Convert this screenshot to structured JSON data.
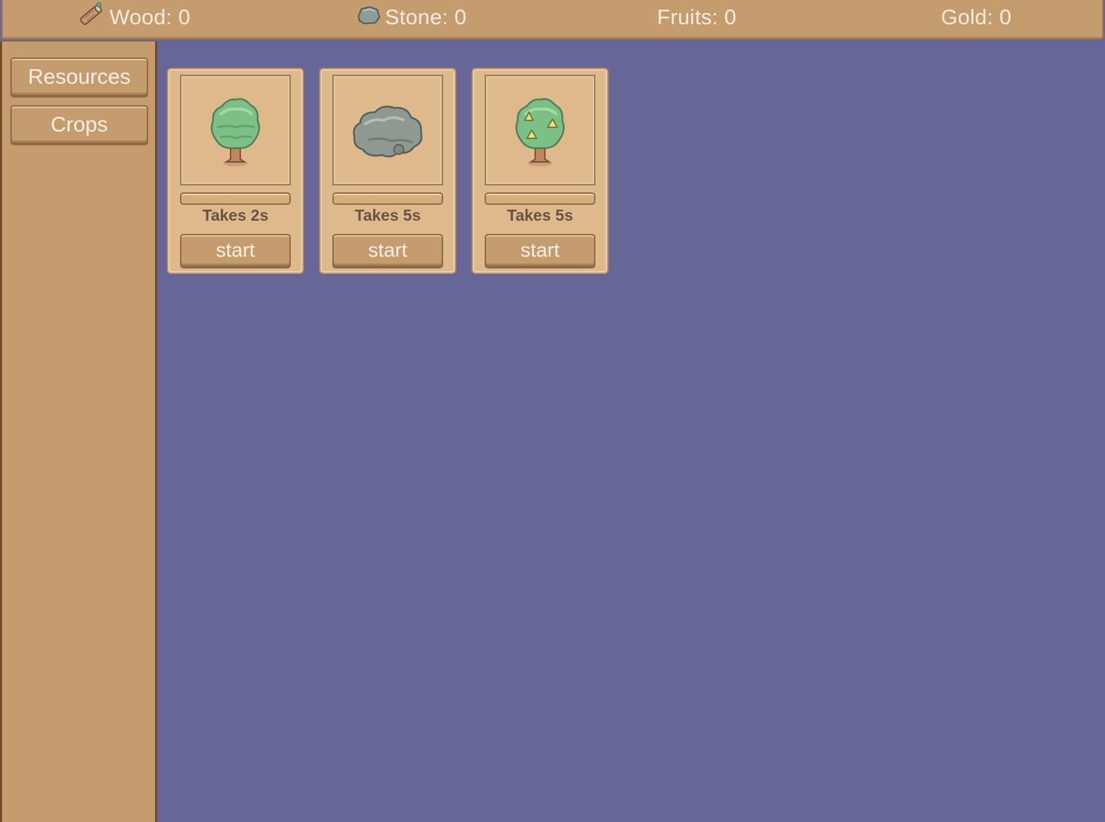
{
  "resources": [
    {
      "label": "Wood: 0",
      "icon": "wood-log-icon"
    },
    {
      "label": "Stone: 0",
      "icon": "stone-icon"
    },
    {
      "label": "Fruits: 0",
      "icon": ""
    },
    {
      "label": "Gold: 0",
      "icon": ""
    }
  ],
  "sidebar": {
    "items": [
      {
        "label": "Resources"
      },
      {
        "label": "Crops"
      }
    ]
  },
  "cards": [
    {
      "icon": "tree-icon",
      "time_label": "Takes 2s",
      "button_label": "start",
      "progress": 0
    },
    {
      "icon": "rock-icon",
      "time_label": "Takes 5s",
      "button_label": "start",
      "progress": 0
    },
    {
      "icon": "fruit-tree-icon",
      "time_label": "Takes 5s",
      "button_label": "start",
      "progress": 0
    }
  ],
  "colors": {
    "background": "#666698",
    "panel": "#c49c6e",
    "card": "#deb98c",
    "leaf": "#7dbf83",
    "stone": "#8f9a92",
    "fruit": "#e8e27a"
  }
}
